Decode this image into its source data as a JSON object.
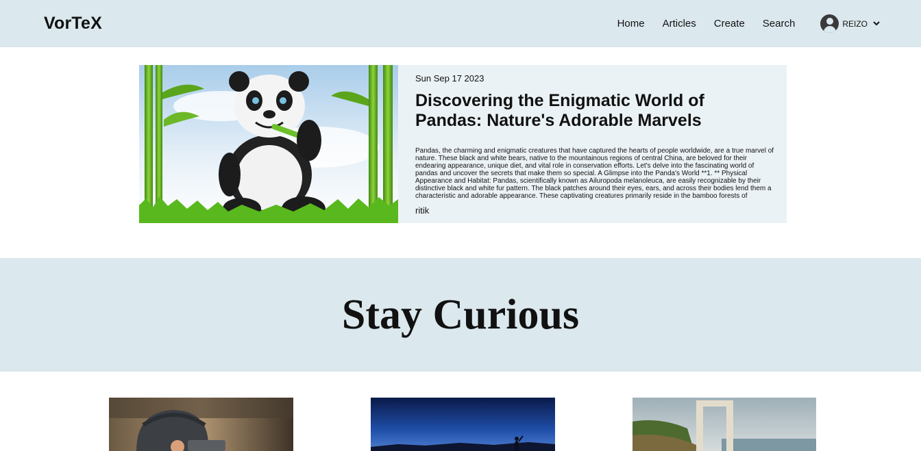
{
  "header": {
    "logo": "VorTeX",
    "nav": [
      "Home",
      "Articles",
      "Create",
      "Search"
    ],
    "user": {
      "name": "REIZO",
      "avatar_icon": "user-circle-icon",
      "menu_icon": "chevron-down-icon"
    }
  },
  "featured": {
    "date": "Sun Sep 17 2023",
    "title": "Discovering the Enigmatic World of Pandas: Nature's Adorable Marvels",
    "excerpt": "Pandas, the charming and enigmatic creatures that have captured the hearts of people worldwide, are a true marvel of nature. These black and white bears, native to the mountainous regions of central China, are beloved for their endearing appearance, unique diet, and vital role in conservation efforts. Let's delve into the fascinating world of pandas and uncover the secrets that make them so special. A Glimpse into the Panda's World **1. ** Physical Appearance and Habitat: Pandas, scientifically known as Ailuropoda melanoleuca, are easily recognizable by their distinctive black and white fur pattern. The black patches around their eyes, ears, and across their bodies lend them a characteristic and adorable appearance. These captivating creatures primarily reside in the bamboo forests of",
    "author": "ritik"
  },
  "banner": {
    "text": "Stay Curious"
  },
  "colors": {
    "nav_bg": "#dbe8ee",
    "card_bg": "#ebf2f5",
    "text": "#111111"
  }
}
